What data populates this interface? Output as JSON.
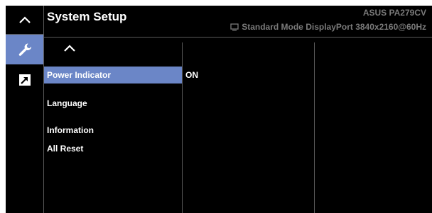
{
  "header": {
    "title": "System Setup",
    "model": "ASUS PA279CV",
    "status_text": "Standard Mode DisplayPort 3840x2160@60Hz",
    "status_icon": "monitor-icon"
  },
  "sidebar": {
    "nav_up_icon": "chevron-up-icon",
    "tabs": [
      {
        "icon": "wrench-icon",
        "active": true
      },
      {
        "icon": "shortcut-arrow-icon",
        "active": false
      }
    ]
  },
  "menu": {
    "nav_up_icon": "chevron-up-icon",
    "items": [
      {
        "label": "Power Indicator",
        "selected": true
      },
      {
        "label": "Language",
        "selected": false
      },
      {
        "label": "Information",
        "selected": false
      },
      {
        "label": "All Reset",
        "selected": false
      }
    ]
  },
  "submenu": {
    "items": [
      {
        "label": "ON"
      }
    ]
  },
  "colors": {
    "background": "#000000",
    "highlight": "#6b86c7",
    "text": "#ffffff",
    "dim_text": "#7a7a7a",
    "separator": "#5a5a5a"
  }
}
